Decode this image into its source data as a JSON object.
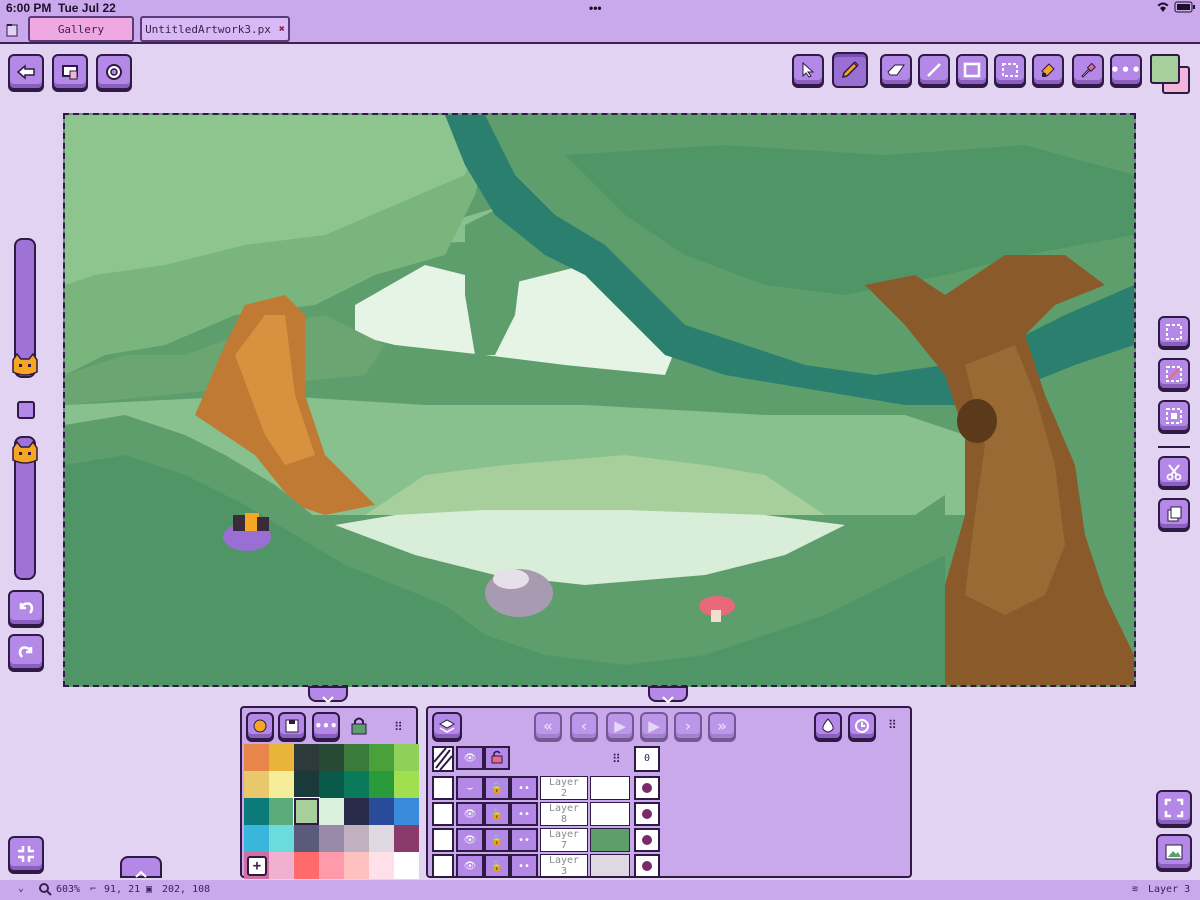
{
  "status": {
    "time": "6:00 PM",
    "date": "Tue Jul 22",
    "dots": "•••"
  },
  "tabs": [
    {
      "label": "Gallery"
    },
    {
      "label": "UntitledArtwork3.px",
      "close": "✖"
    }
  ],
  "toolbar_left": [
    "back-arrow-icon",
    "canvas-settings-icon",
    "settings-gear-icon"
  ],
  "toolbar_right": [
    "move-cursor-icon",
    "pencil-icon",
    "eraser-icon",
    "line-icon",
    "rectangle-icon",
    "selection-icon",
    "fill-bucket-icon",
    "eyedropper-icon",
    "more-icon"
  ],
  "colors": {
    "primary": "#a6cf9c",
    "secondary": "#f0b5d8",
    "accent": "#b388e6"
  },
  "palette": [
    [
      "#e8854a",
      "#e8b43a",
      "#2c3a3a",
      "#274a35",
      "#3a7a3a",
      "#4aa03a",
      "#8ed05a"
    ],
    [
      "#e8c86a",
      "#f5ed9a",
      "#1a3a3a",
      "#0a5a4a",
      "#0a7a5a",
      "#2a9a3a",
      "#a0e050"
    ],
    [
      "#0a7a7a",
      "#5aaa7a",
      "#a6cf9c",
      "#daf0dc",
      "#2a2a4a",
      "#2a4a9a",
      "#3a8adc"
    ],
    [
      "#3ab5dc",
      "#6adcdc",
      "#5a5a7a",
      "#9a8aaa",
      "#c0b0c0",
      "#e0d8e0",
      "#8a3a6a"
    ],
    [
      "#d070a0",
      "#f0b0d0",
      "#ff6a6a",
      "#ff9aaa",
      "#ffc0c0",
      "#ffe0e8",
      "#ffffff"
    ]
  ],
  "palette_panel": {
    "add": "+"
  },
  "animation_panel": {
    "frame": "0"
  },
  "layers": [
    {
      "name": "Layer\n2"
    },
    {
      "name": "Layer\n8"
    },
    {
      "name": "Layer\n7"
    },
    {
      "name": "Layer\n3"
    }
  ],
  "bottom": {
    "zoom": "603%",
    "cursor": "91, 21",
    "size": "202, 108",
    "layer": "Layer 3"
  }
}
